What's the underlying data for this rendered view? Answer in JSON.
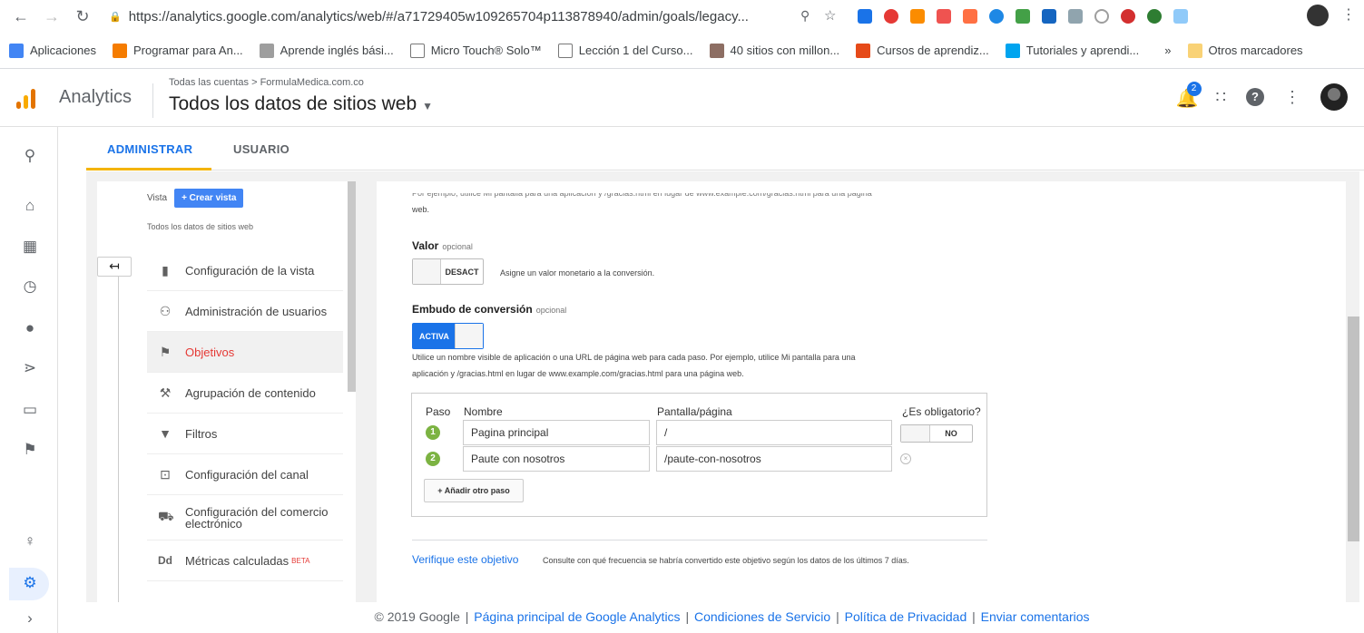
{
  "browser": {
    "url": "https://analytics.google.com/analytics/web/#/a71729405w109265704p113878940/admin/goals/legacy...",
    "bookmarks": [
      {
        "label": "Aplicaciones",
        "color": "#4285f4"
      },
      {
        "label": "Programar para An...",
        "color": "#f57c00"
      },
      {
        "label": "Aprende inglés bási...",
        "color": "#9e9e9e"
      },
      {
        "label": "Micro Touch® Solo™",
        "color": "#ffffff"
      },
      {
        "label": "Lección 1 del Curso...",
        "color": "#ffffff"
      },
      {
        "label": "40 sitios con millon...",
        "color": "#8d6e63"
      },
      {
        "label": "Cursos de aprendiz...",
        "color": "#e64a19"
      },
      {
        "label": "Tutoriales y aprendi...",
        "color": "#00a4ef"
      }
    ],
    "more": "»",
    "other_bookmarks": "Otros marcadores"
  },
  "header": {
    "app_name": "Analytics",
    "breadcrumb": "Todas las cuentas > FormulaMedica.com.co",
    "title": "Todos los datos de sitios web",
    "notifications": "2"
  },
  "tabs": [
    {
      "label": "ADMINISTRAR"
    },
    {
      "label": "USUARIO"
    }
  ],
  "view": {
    "label": "Vista",
    "create_button": "+ Crear vista",
    "name": "Todos los datos de sitios web"
  },
  "menu": [
    {
      "label": "Configuración de la vista",
      "icon": "document-icon"
    },
    {
      "label": "Administración de usuarios",
      "icon": "people-icon"
    },
    {
      "label": "Objetivos",
      "icon": "flag-icon"
    },
    {
      "label": "Agrupación de contenido",
      "icon": "tool-icon"
    },
    {
      "label": "Filtros",
      "icon": "filter-icon"
    },
    {
      "label": "Configuración del canal",
      "icon": "channel-icon"
    },
    {
      "label": "Configuración del comercio electrónico",
      "icon": "cart-icon"
    },
    {
      "label": "Métricas calculadas",
      "badge": "BETA",
      "icon": "dd-icon"
    }
  ],
  "goal_form": {
    "cut_text_1": "Por ejemplo, utilice Mi pantalla para una aplicación y /gracias.html en lugar de www.example.com/gracias.html para una página",
    "cut_text_2": "web.",
    "value": {
      "title": "Valor",
      "optional": "opcional",
      "toggle_label": "DESACT",
      "description": "Asigne un valor monetario a la conversión."
    },
    "funnel": {
      "title": "Embudo de conversión",
      "optional": "opcional",
      "toggle_label": "ACTIVA",
      "desc_line1": "Utilice un nombre visible de aplicación o una URL de página web para cada paso. Por ejemplo, utilice Mi pantalla para una",
      "desc_line2": "aplicación y /gracias.html en lugar de www.example.com/gracias.html para una página web.",
      "headers": {
        "step": "Paso",
        "name": "Nombre",
        "screen": "Pantalla/página",
        "required": "¿Es obligatorio?"
      },
      "steps": [
        {
          "num": "1",
          "name": "Pagina principal",
          "screen": "/"
        },
        {
          "num": "2",
          "name": "Paute con nosotros",
          "screen": "/paute-con-nosotros"
        }
      ],
      "required_toggle": "NO",
      "add_step": "+ Añadir otro paso"
    },
    "verify": {
      "link": "Verifique este objetivo",
      "description": "Consulte con qué frecuencia se habría convertido este objetivo según los datos de los últimos 7 días."
    }
  },
  "footer": {
    "copyright": "© 2019 Google",
    "links": [
      "Página principal de Google Analytics",
      "Condiciones de Servicio",
      "Política de Privacidad",
      "Enviar comentarios"
    ],
    "separator": "|"
  }
}
